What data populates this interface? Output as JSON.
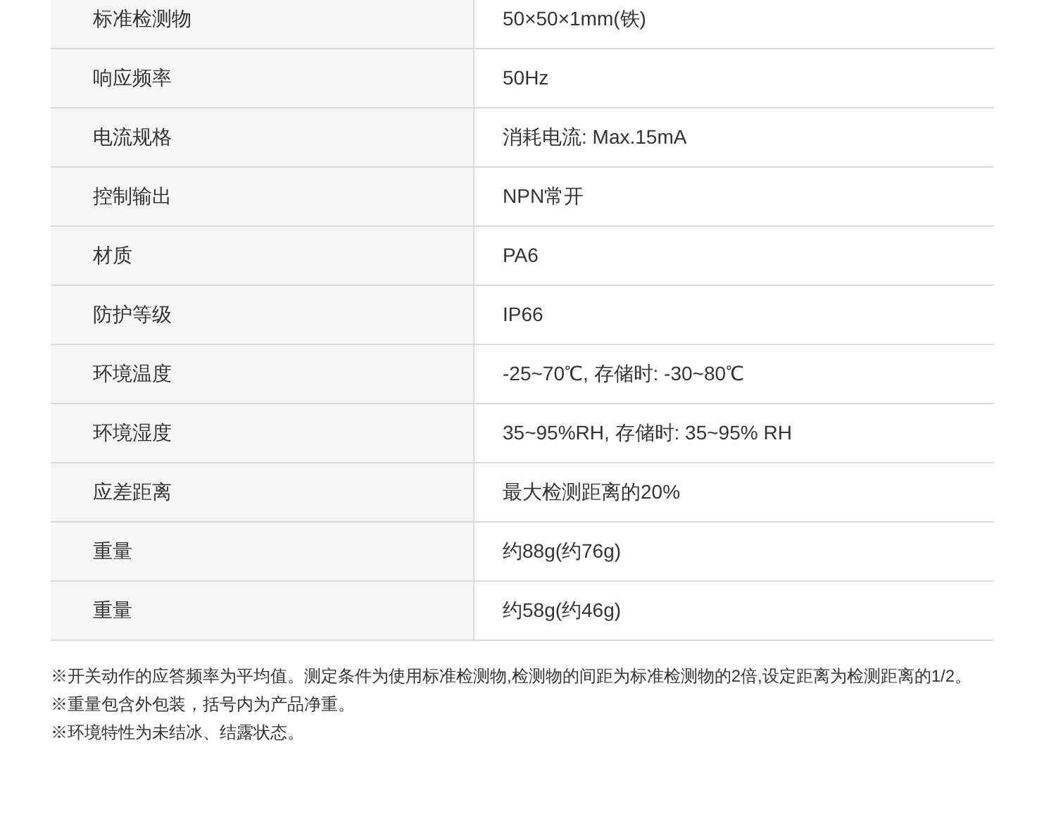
{
  "specs": [
    {
      "label": "标准检测物",
      "value": "50×50×1mm(铁)"
    },
    {
      "label": "响应频率",
      "value": "50Hz"
    },
    {
      "label": "电流规格",
      "value": "消耗电流: Max.15mA"
    },
    {
      "label": "控制输出",
      "value": "NPN常开"
    },
    {
      "label": "材质",
      "value": "PA6"
    },
    {
      "label": "防护等级",
      "value": "IP66"
    },
    {
      "label": "环境温度",
      "value": "-25~70℃, 存储时: -30~80℃"
    },
    {
      "label": "环境湿度",
      "value": "35~95%RH, 存储时: 35~95% RH"
    },
    {
      "label": "应差距离",
      "value": "最大检测距离的20%"
    },
    {
      "label": "重量",
      "value": "约88g(约76g)"
    },
    {
      "label": "重量",
      "value": "约58g(约46g)"
    }
  ],
  "notes": [
    "※开关动作的应答频率为平均值。测定条件为使用标准检测物,检测物的间距为标准检测物的2倍,设定距离为检测距离的1/2。",
    "※重量包含外包装，括号内为产品净重。",
    "※环境特性为未结冰、结露状态。"
  ]
}
